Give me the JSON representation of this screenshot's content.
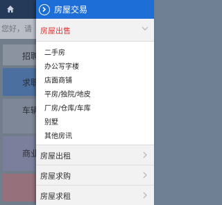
{
  "background": {
    "search_placeholder": "您好，请",
    "cards": [
      "招聘",
      "求职",
      "车辆",
      "商业"
    ]
  },
  "drawer": {
    "title": "房屋交易",
    "expanded_section": {
      "label": "房屋出售",
      "items": [
        "二手房",
        "办公写字楼",
        "店面商铺",
        "平房/独院/地皮",
        "厂房/仓库/车库",
        "别墅",
        "其他房讯"
      ]
    },
    "collapsed_sections": [
      "房屋出租",
      "房屋求购",
      "房屋求租"
    ]
  },
  "colors": {
    "header_bg": "#1e6ed8",
    "active_label": "#e43434",
    "menu_bg": "#f2f2f2"
  }
}
